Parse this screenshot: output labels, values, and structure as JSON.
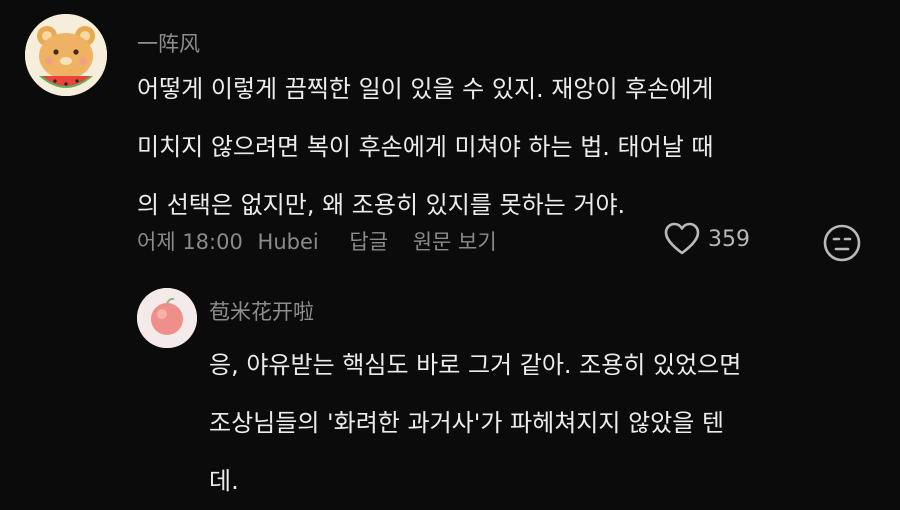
{
  "comment": {
    "username": "一阵风",
    "lines": [
      "어떻게 이렇게 끔찍한 일이 있을 수 있지. 재앙이 후손에게",
      "미치지 않으려면 복이 후손에게 미쳐야 하는 법. 태어날 때",
      "의 선택은 없지만, 왜 조용히 있지를 못하는 거야."
    ],
    "time": "어제 18:00",
    "location": "Hubei",
    "reply_label": "답글",
    "original_label": "원문 보기",
    "like_count": "359",
    "icons": {
      "like": "heart-icon",
      "react": "neutral-face-icon"
    }
  },
  "reply": {
    "username": "苞米花开啦",
    "lines": [
      "응, 야유받는 핵심도 바로 그거 같아. 조용히 있었으면",
      "조상님들의 '화려한 과거사'가 파헤쳐지지 않았을 텐",
      "데."
    ]
  }
}
